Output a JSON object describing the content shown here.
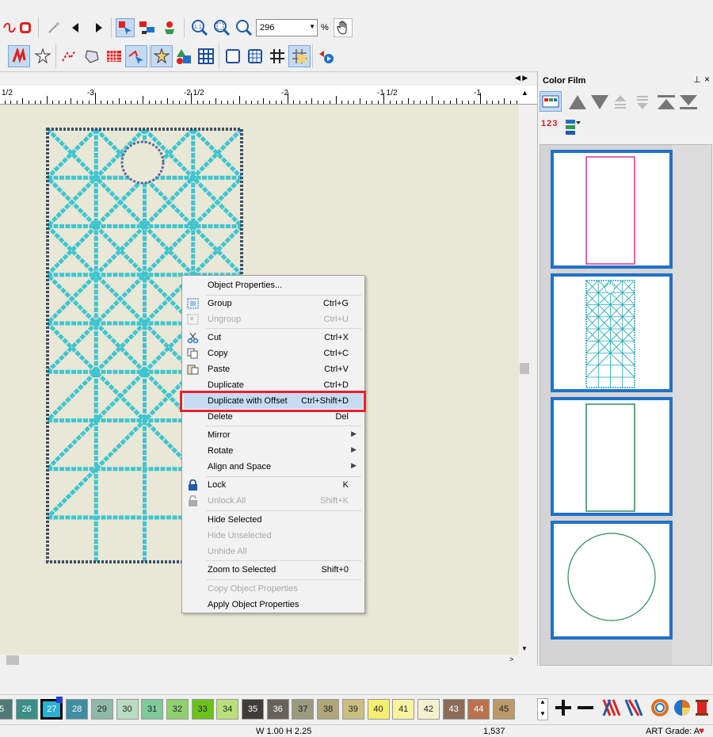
{
  "toolbar": {
    "zoom_value": "296",
    "zoom_unit": "%"
  },
  "ruler": {
    "labels": [
      "1/2",
      "-3",
      "-2 1/2",
      "-2",
      "-1 1/2",
      "-1"
    ]
  },
  "context_menu": {
    "items": [
      {
        "label": "Object Properties...",
        "shortcut": "",
        "disabled": false
      },
      {
        "label": "Group",
        "shortcut": "Ctrl+G",
        "disabled": false
      },
      {
        "label": "Ungroup",
        "shortcut": "Ctrl+U",
        "disabled": true
      },
      {
        "label": "Cut",
        "shortcut": "Ctrl+X",
        "disabled": false
      },
      {
        "label": "Copy",
        "shortcut": "Ctrl+C",
        "disabled": false
      },
      {
        "label": "Paste",
        "shortcut": "Ctrl+V",
        "disabled": false
      },
      {
        "label": "Duplicate",
        "shortcut": "Ctrl+D",
        "disabled": false
      },
      {
        "label": "Duplicate with Offset",
        "shortcut": "Ctrl+Shift+D",
        "disabled": false,
        "highlighted": true
      },
      {
        "label": "Delete",
        "shortcut": "Del",
        "disabled": false
      },
      {
        "label": "Mirror",
        "shortcut": "",
        "disabled": false
      },
      {
        "label": "Rotate",
        "shortcut": "",
        "disabled": false
      },
      {
        "label": "Align and Space",
        "shortcut": "",
        "disabled": false
      },
      {
        "label": "Lock",
        "shortcut": "K",
        "disabled": false
      },
      {
        "label": "Unlock All",
        "shortcut": "Shift+K",
        "disabled": true
      },
      {
        "label": "Hide Selected",
        "shortcut": "",
        "disabled": false
      },
      {
        "label": "Hide Unselected",
        "shortcut": "",
        "disabled": true
      },
      {
        "label": "Unhide All",
        "shortcut": "",
        "disabled": true
      },
      {
        "label": "Zoom to Selected",
        "shortcut": "Shift+0",
        "disabled": false
      },
      {
        "label": "Copy Object Properties",
        "shortcut": "",
        "disabled": true
      },
      {
        "label": "Apply Object Properties",
        "shortcut": "",
        "disabled": false
      }
    ],
    "highlight_color": "#e8202e"
  },
  "color_film": {
    "title": "Color Film",
    "order_label": "1 2 3",
    "thumb_colors": [
      "#d6338f",
      "#1fa6b8",
      "#2e8b57",
      "#2e8b57"
    ],
    "border_color": "#1f72c8"
  },
  "palette": {
    "swatches": [
      {
        "num": "5",
        "color": "#4f7a77"
      },
      {
        "num": "26",
        "color": "#3a8f86"
      },
      {
        "num": "27",
        "color": "#2bb0d0",
        "selected": true
      },
      {
        "num": "28",
        "color": "#3f8ea0"
      },
      {
        "num": "29",
        "color": "#8fb8a8"
      },
      {
        "num": "30",
        "color": "#b9dcc2"
      },
      {
        "num": "31",
        "color": "#7fc99a"
      },
      {
        "num": "32",
        "color": "#8fd06e"
      },
      {
        "num": "33",
        "color": "#6cc21c"
      },
      {
        "num": "34",
        "color": "#b9e07a"
      },
      {
        "num": "35",
        "color": "#3f3d39"
      },
      {
        "num": "36",
        "color": "#66625b"
      },
      {
        "num": "37",
        "color": "#9a9a7e"
      },
      {
        "num": "38",
        "color": "#b1a67a"
      },
      {
        "num": "39",
        "color": "#c9bf82"
      },
      {
        "num": "40",
        "color": "#f5ef71"
      },
      {
        "num": "41",
        "color": "#f7f2a0"
      },
      {
        "num": "42",
        "color": "#f4f1cf"
      },
      {
        "num": "43",
        "color": "#8c6d58"
      },
      {
        "num": "44",
        "color": "#b9734f"
      },
      {
        "num": "45",
        "color": "#b99a6a"
      }
    ]
  },
  "status": {
    "dimensions": "W 1.00 H 2.25",
    "stitches": "1,537",
    "art_grade": "ART Grade: A"
  },
  "colors": {
    "stitch": "#3fc5cf",
    "stitch_dark": "#3a4f6b",
    "canvas_bg": "#e9e7d6"
  }
}
